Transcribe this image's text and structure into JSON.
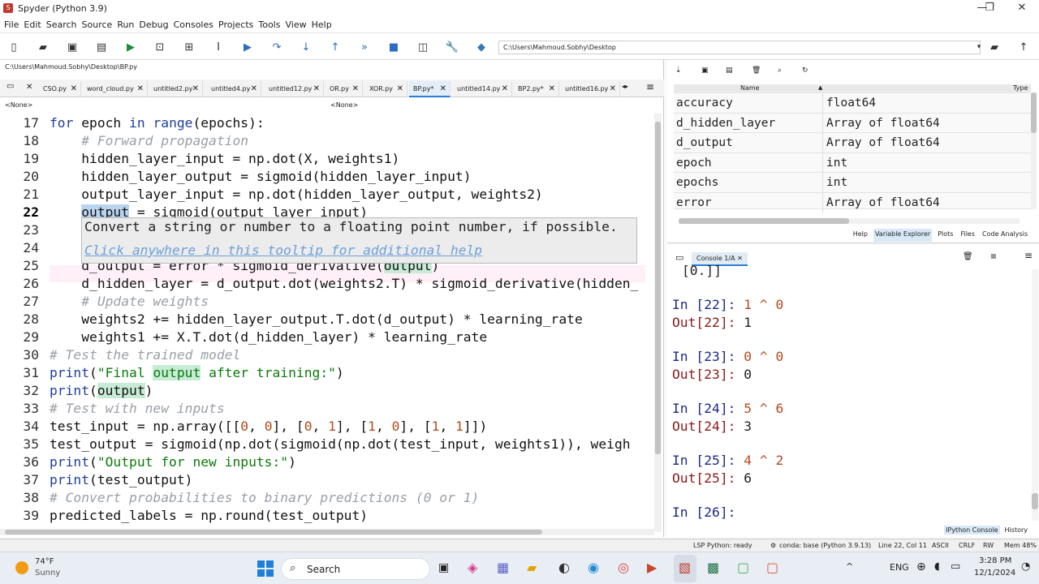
{
  "window": {
    "title": "Spyder (Python 3.9)",
    "minimize": "—",
    "maximize": "❐",
    "close": "✕"
  },
  "menu": [
    "File",
    "Edit",
    "Search",
    "Source",
    "Run",
    "Debug",
    "Consoles",
    "Projects",
    "Tools",
    "View",
    "Help"
  ],
  "toolbar": {
    "working_dir": "C:\\Users\\Mahmoud.Sobhy\\Desktop"
  },
  "editor": {
    "file_path": "C:\\Users\\Mahmoud.Sobhy\\Desktop\\BP.py",
    "tabs": [
      "CSO.py",
      "word_cloud.py",
      "untitled2.py",
      "untitled4.py",
      "untitled12.py",
      "OR.py",
      "XOR.py",
      "BP.py*",
      "untitled14.py",
      "BP2.py*",
      "untitled16.py"
    ],
    "selector_left": "<None>",
    "selector_right": "<None>",
    "current_line": 22,
    "tooltip": {
      "text": "Convert a string or number to a floating point number, if possible.",
      "help": "Click anywhere in this tooltip for additional help"
    },
    "lines": [
      {
        "n": "17",
        "code": "for epoch in range(epochs):"
      },
      {
        "n": "18",
        "code": "    # Forward propagation"
      },
      {
        "n": "19",
        "code": "    hidden_layer_input = np.dot(X, weights1)"
      },
      {
        "n": "20",
        "code": "    hidden_layer_output = sigmoid(hidden_layer_input)"
      },
      {
        "n": "21",
        "code": "    output_layer_input = np.dot(hidden_layer_output, weights2)"
      },
      {
        "n": "22",
        "code": "    output = sigmoid(output_layer_input)"
      },
      {
        "n": "23",
        "code": ""
      },
      {
        "n": "24",
        "code": ""
      },
      {
        "n": "25",
        "code": "    d_output = error * sigmoid_derivative(output)"
      },
      {
        "n": "26",
        "code": "    d_hidden_layer = d_output.dot(weights2.T) * sigmoid_derivative(hidden_"
      },
      {
        "n": "27",
        "code": "    # Update weights"
      },
      {
        "n": "28",
        "code": "    weights2 += hidden_layer_output.T.dot(d_output) * learning_rate"
      },
      {
        "n": "29",
        "code": "    weights1 += X.T.dot(d_hidden_layer) * learning_rate"
      },
      {
        "n": "30",
        "code": "# Test the trained model"
      },
      {
        "n": "31",
        "code": "print(\"Final output after training:\")"
      },
      {
        "n": "32",
        "code": "print(output)"
      },
      {
        "n": "33",
        "code": "# Test with new inputs"
      },
      {
        "n": "34",
        "code": "test_input = np.array([[0, 0], [0, 1], [1, 0], [1, 1]])"
      },
      {
        "n": "35",
        "code": "test_output = sigmoid(np.dot(sigmoid(np.dot(test_input, weights1)), weigh"
      },
      {
        "n": "36",
        "code": "print(\"Output for new inputs:\")"
      },
      {
        "n": "37",
        "code": "print(test_output)"
      },
      {
        "n": "38",
        "code": "# Convert probabilities to binary predictions (0 or 1)"
      },
      {
        "n": "39",
        "code": "predicted_labels = np.round(test_output)"
      }
    ]
  },
  "variable_explorer": {
    "columns": [
      "Name",
      "Type"
    ],
    "rows": [
      {
        "name": "accuracy",
        "type": "float64"
      },
      {
        "name": "d_hidden_layer",
        "type": "Array of float64"
      },
      {
        "name": "d_output",
        "type": "Array of float64"
      },
      {
        "name": "epoch",
        "type": "int"
      },
      {
        "name": "epochs",
        "type": "int"
      },
      {
        "name": "error",
        "type": "Array of float64"
      }
    ],
    "tabs": [
      "Help",
      "Variable Explorer",
      "Plots",
      "Files",
      "Code Analysis"
    ]
  },
  "console": {
    "tab": "Console 1/A",
    "partial_top": "[0.]]",
    "entries": [
      {
        "in_label": "In [22]:",
        "input": "1 ^ 0",
        "out_label": "Out[22]:",
        "output": "1"
      },
      {
        "in_label": "In [23]:",
        "input": "0 ^ 0",
        "out_label": "Out[23]:",
        "output": "0"
      },
      {
        "in_label": "In [24]:",
        "input": "5 ^ 6",
        "out_label": "Out[24]:",
        "output": "3"
      },
      {
        "in_label": "In [25]:",
        "input": "4 ^ 2",
        "out_label": "Out[25]:",
        "output": "6"
      }
    ],
    "prompt": "In [26]:",
    "tabs": [
      "IPython Console",
      "History"
    ]
  },
  "statusbar": {
    "lsp": "LSP Python: ready",
    "env": "conda: base (Python 3.9.13)",
    "pos": "Line 22, Col 11",
    "enc": "ASCII",
    "eol": "CRLF",
    "rw": "RW",
    "mem": "Mem 48%"
  },
  "taskbar": {
    "weather_temp": "74°F",
    "weather_desc": "Sunny",
    "search": "Search",
    "lang": "ENG",
    "time": "3:28 PM",
    "date": "12/1/2024"
  }
}
